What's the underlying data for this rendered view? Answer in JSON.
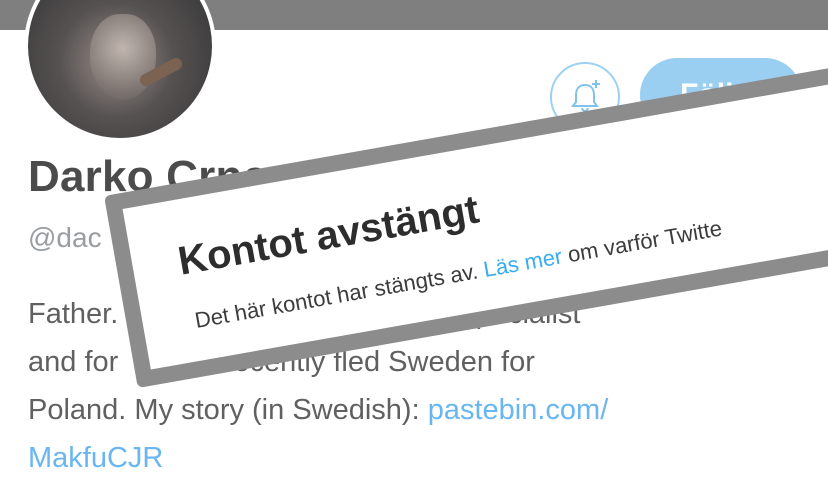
{
  "profile": {
    "name": "Darko Crncevic",
    "handle": "@dac",
    "bio": {
      "lines": [
        "Father.",
        "Specialist",
        "and for",
        "r. Recently fled Sweden for",
        "Poland. My story (in Swedish): "
      ],
      "link_text": "pastebin.com/",
      "link_text_2": "MakfuCJR"
    }
  },
  "actions": {
    "follow_label": "Följer",
    "bell_icon": "bell-plus-icon"
  },
  "suspension": {
    "title": "Kontot avstängt",
    "message_prefix": "Det här kontot har stängts av. ",
    "link_label": "Läs mer",
    "message_suffix": " om varför Twitte"
  },
  "colors": {
    "banner": "#6e6e6e",
    "accent": "#8cc9ef",
    "link": "#55acee",
    "overlay_border": "#7d7d7d"
  }
}
